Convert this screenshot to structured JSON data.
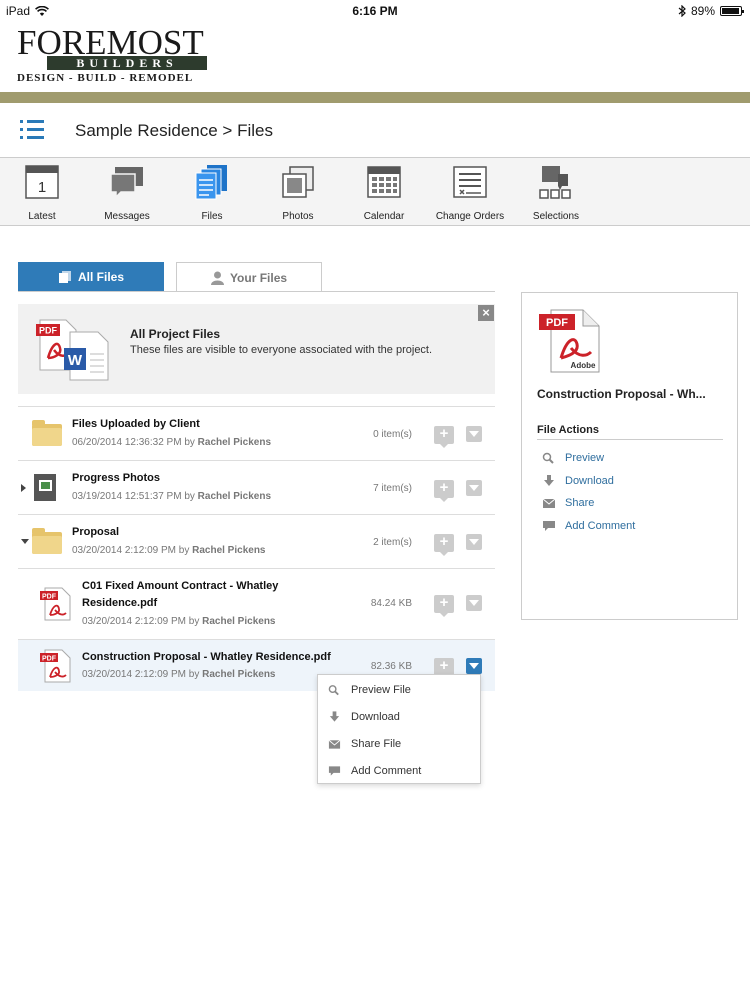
{
  "status": {
    "device": "iPad",
    "time": "6:16 PM",
    "battery": "89%"
  },
  "logo": {
    "line1": "FOREMOST",
    "line2": "BUILDERS",
    "line3": "DESIGN - BUILD - REMODEL"
  },
  "header": {
    "title": "Sample Residence > Files"
  },
  "toolbar": [
    {
      "label": "Latest",
      "icon": "calendar-day-icon",
      "badge": "1"
    },
    {
      "label": "Messages",
      "icon": "chat-bubbles-icon"
    },
    {
      "label": "Files",
      "icon": "files-icon"
    },
    {
      "label": "Photos",
      "icon": "photos-icon"
    },
    {
      "label": "Calendar",
      "icon": "calendar-grid-icon"
    },
    {
      "label": "Change Orders",
      "icon": "change-orders-icon"
    },
    {
      "label": "Selections",
      "icon": "selections-icon"
    }
  ],
  "tabs": {
    "all": "All Files",
    "yours": "Your Files"
  },
  "banner": {
    "title": "All Project Files",
    "description": "These files are visible to everyone associated with the project."
  },
  "files": [
    {
      "name": "Files Uploaded by Client",
      "date": "06/20/2014 12:36:32 PM",
      "by": "by",
      "author": "Rachel Pickens",
      "size": "0 item(s)",
      "type": "folder"
    },
    {
      "name": "Progress Photos",
      "date": "03/19/2014 12:51:37 PM",
      "by": "by",
      "author": "Rachel Pickens",
      "size": "7 item(s)",
      "type": "photo-folder"
    },
    {
      "name": "Proposal",
      "date": "03/20/2014 2:12:09 PM",
      "by": "by",
      "author": "Rachel Pickens",
      "size": "2 item(s)",
      "type": "folder"
    },
    {
      "name": "C01 Fixed Amount Contract - Whatley Residence.pdf",
      "date": "03/20/2014 2:12:09 PM",
      "by": "by",
      "author": "Rachel Pickens",
      "size": "84.24 KB",
      "type": "pdf"
    },
    {
      "name": "Construction Proposal - Whatley Residence.pdf",
      "date": "03/20/2014 2:12:09 PM",
      "by": "by",
      "author": "Rachel Pickens",
      "size": "82.36 KB",
      "type": "pdf"
    }
  ],
  "panel": {
    "doc_title": "Construction Proposal - Wh...",
    "actions_title": "File Actions",
    "actions": [
      "Preview",
      "Download",
      "Share",
      "Add Comment"
    ]
  },
  "menu": [
    "Preview File",
    "Download",
    "Share File",
    "Add Comment"
  ],
  "colors": {
    "accent": "#2f7bb8",
    "olive": "#a09b6e",
    "pdf_red": "#cc2229"
  }
}
